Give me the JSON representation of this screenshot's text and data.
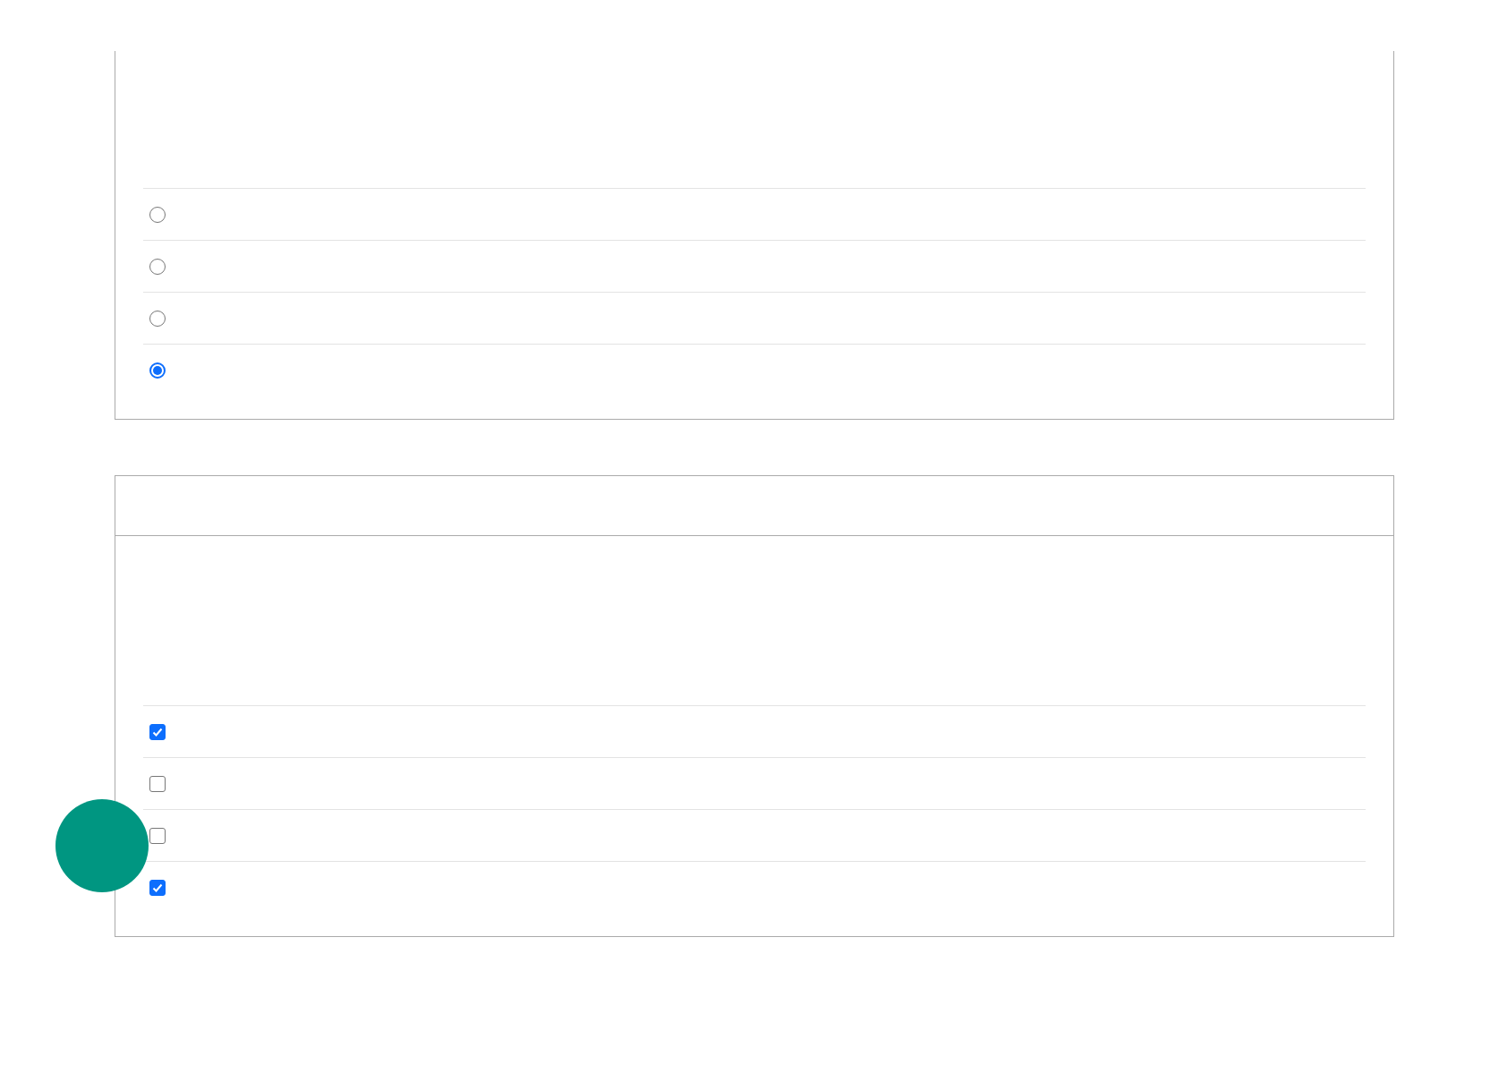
{
  "questions": [
    {
      "kind": "radio",
      "options": [
        {
          "selected": false
        },
        {
          "selected": false
        },
        {
          "selected": false
        },
        {
          "selected": true
        }
      ]
    },
    {
      "kind": "checkbox",
      "options": [
        {
          "checked": true
        },
        {
          "checked": false
        },
        {
          "checked": false
        },
        {
          "checked": true
        }
      ]
    }
  ]
}
